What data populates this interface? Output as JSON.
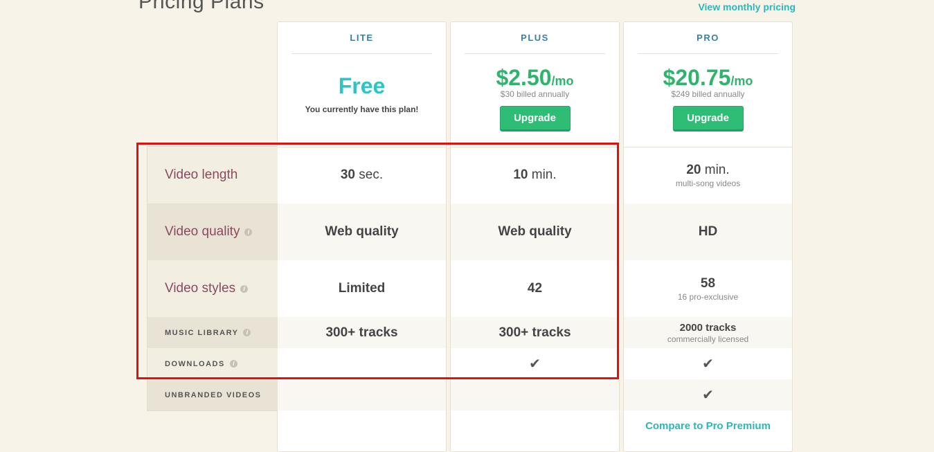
{
  "page": {
    "title": "Pricing Plans",
    "monthly_link": "View monthly pricing"
  },
  "features": [
    {
      "label": "Video length",
      "has_info": false
    },
    {
      "label": "Video quality",
      "has_info": true
    },
    {
      "label": "Video styles",
      "has_info": true
    },
    {
      "label": "MUSIC LIBRARY",
      "has_info": true
    },
    {
      "label": "DOWNLOADS",
      "has_info": true
    },
    {
      "label": "UNBRANDED VIDEOS",
      "has_info": false
    }
  ],
  "info_glyph": "i",
  "plans": {
    "lite": {
      "name": "LITE",
      "price": "Free",
      "note": "You currently have this plan!",
      "video_length_num": "30",
      "video_length_unit": "sec.",
      "video_quality": "Web quality",
      "video_styles": "Limited",
      "music_library": "300+ tracks",
      "downloads": false,
      "unbranded": false
    },
    "plus": {
      "name": "PLUS",
      "price": "$2.50",
      "per": "/mo",
      "billed": "$30 billed annually",
      "button": "Upgrade",
      "video_length_num": "10",
      "video_length_unit": "min.",
      "video_quality": "Web quality",
      "video_styles": "42",
      "music_library": "300+ tracks",
      "downloads": true,
      "unbranded": false
    },
    "pro": {
      "name": "PRO",
      "price": "$20.75",
      "per": "/mo",
      "billed": "$249 billed annually",
      "button": "Upgrade",
      "video_length_num": "20",
      "video_length_unit": "min.",
      "video_length_sub": "multi-song videos",
      "video_quality": "HD",
      "video_styles": "58",
      "video_styles_sub": "16 pro-exclusive",
      "music_library": "2000 tracks",
      "music_library_sub": "commercially licensed",
      "downloads": true,
      "unbranded": true,
      "compare_link": "Compare to Pro Premium"
    }
  },
  "check_glyph": "✔",
  "colors": {
    "background": "#f7f3e8",
    "accent_teal": "#2bb7b7",
    "price_green": "#2db56b",
    "feature_label": "#8a4a5e",
    "highlight_red": "#e01010"
  }
}
